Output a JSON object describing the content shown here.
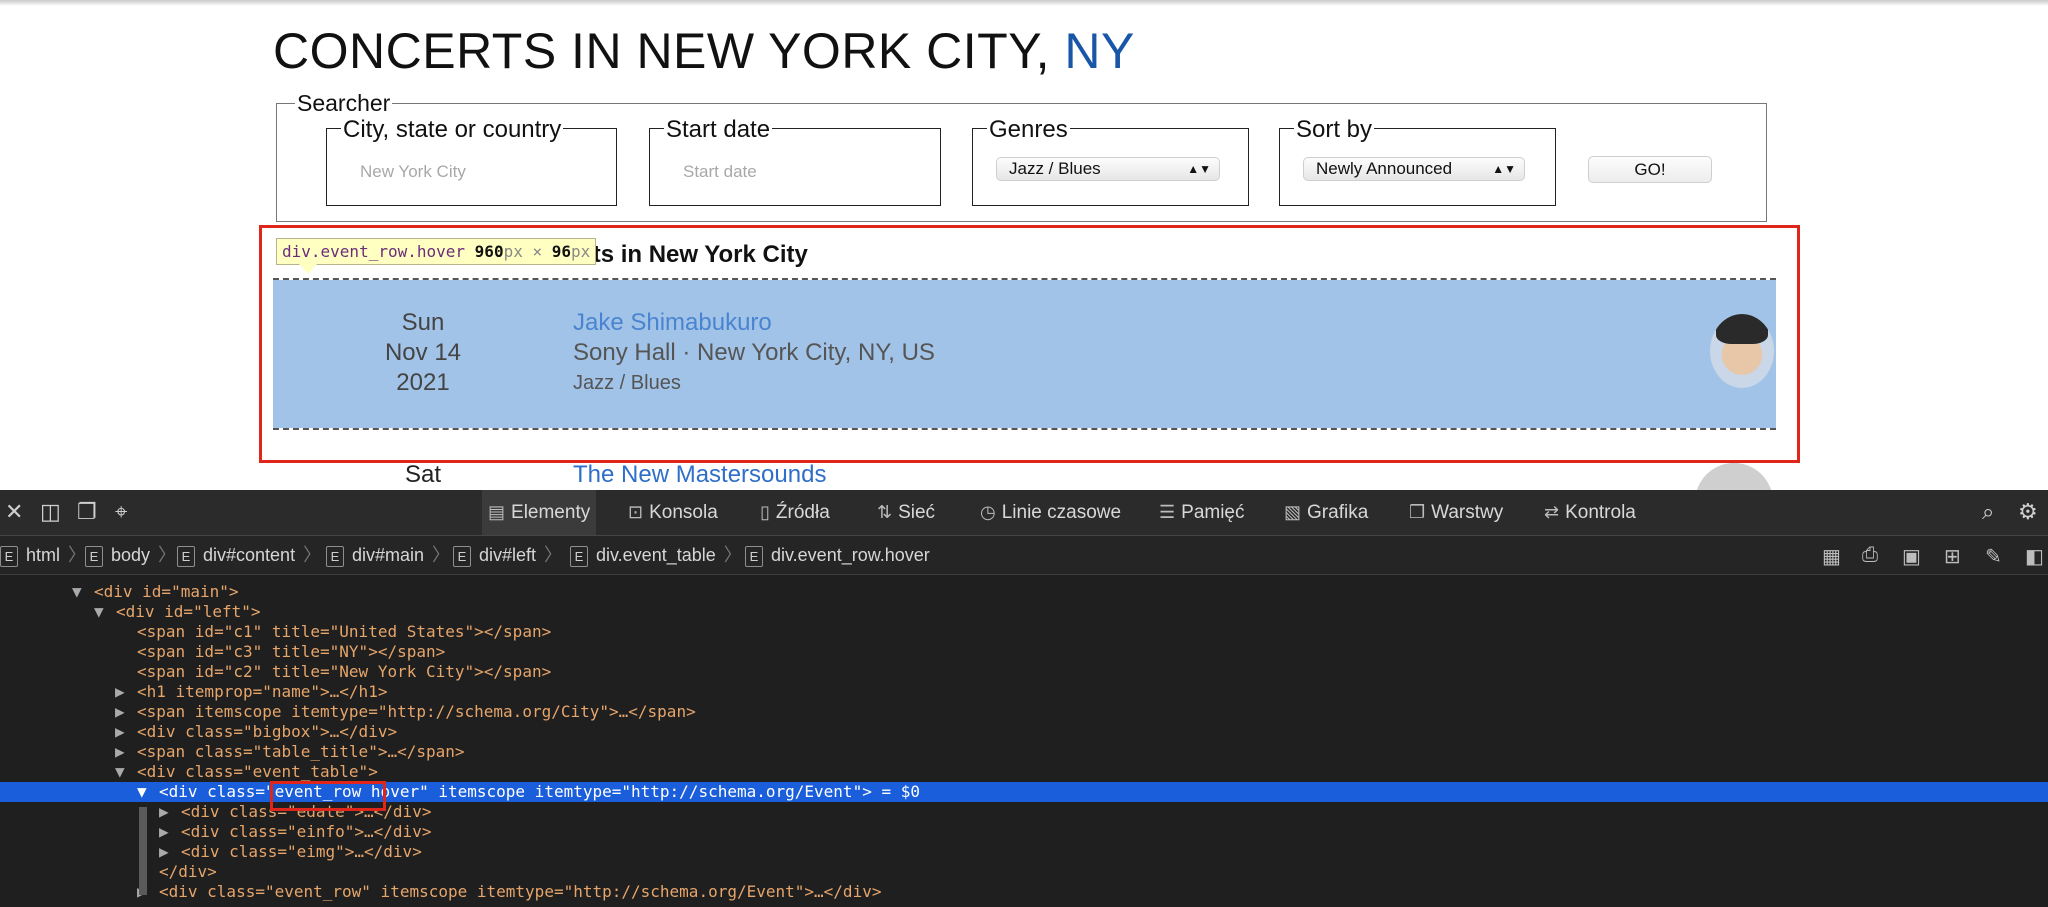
{
  "page": {
    "heading_main": "CONCERTS IN NEW YORK CITY, ",
    "heading_state": "NY",
    "searcher": {
      "legend": "Searcher",
      "city": {
        "label": "City, state or country",
        "placeholder": "New York City"
      },
      "start": {
        "label": "Start date",
        "placeholder": "Start date"
      },
      "genres": {
        "label": "Genres",
        "value": "Jazz / Blues"
      },
      "sort": {
        "label": "Sort by",
        "value": "Newly Announced"
      },
      "go_label": "GO!"
    },
    "table_title_visible": "ncerts in New York City",
    "tooltip": {
      "selector": "div.event_row.hover",
      "w": "960",
      "h": "96",
      "unit": "px",
      "times": " × "
    },
    "events": [
      {
        "day": "Sun",
        "date": "Nov 14",
        "year": "2021",
        "artist": "Jake Shimabukuro",
        "venue": "Sony Hall · New York City, NY, US",
        "genre": "Jazz / Blues"
      },
      {
        "day": "Sat",
        "artist": "The New Mastersounds"
      }
    ]
  },
  "devtools": {
    "tabs": [
      {
        "label": "Elementy",
        "icon": "elements-icon"
      },
      {
        "label": "Konsola",
        "icon": "console-icon"
      },
      {
        "label": "Źródła",
        "icon": "sources-icon"
      },
      {
        "label": "Sieć",
        "icon": "network-icon"
      },
      {
        "label": "Linie czasowe",
        "icon": "timelines-icon"
      },
      {
        "label": "Pamięć",
        "icon": "storage-icon"
      },
      {
        "label": "Grafika",
        "icon": "graphics-icon"
      },
      {
        "label": "Warstwy",
        "icon": "layers-icon"
      },
      {
        "label": "Kontrola",
        "icon": "audit-icon"
      }
    ],
    "breadcrumbs": [
      "html",
      "body",
      "div#content",
      "div#main",
      "div#left",
      "div.event_table",
      "div.event_row.hover"
    ],
    "code_lines": [
      "<div id=\"main\">",
      "<div id=\"left\">",
      "<span id=\"c1\" title=\"United States\"></span>",
      "<span id=\"c3\" title=\"NY\"></span>",
      "<span id=\"c2\" title=\"New York City\"></span>",
      "<h1 itemprop=\"name\">…</h1>",
      "<span itemscope itemtype=\"http://schema.org/City\">…</span>",
      "<div class=\"bigbox\">…</div>",
      "<span class=\"table_title\">…</span>",
      "<div class=\"event_table\">",
      "<div class=\"event_row hover\" itemscope itemtype=\"http://schema.org/Event\"> = $0",
      "<div class=\"edate\">…</div>",
      "<div class=\"einfo\">…</div>",
      "<div class=\"eimg\">…</div>",
      "</div>",
      "<div class=\"event_row\" itemscope itemtype=\"http://schema.org/Event\">…</div>"
    ]
  },
  "colors": {
    "highlight": "#a2c3e8",
    "selection": "#1b5edb",
    "outline": "#e0251b",
    "link": "#4a84d0"
  }
}
